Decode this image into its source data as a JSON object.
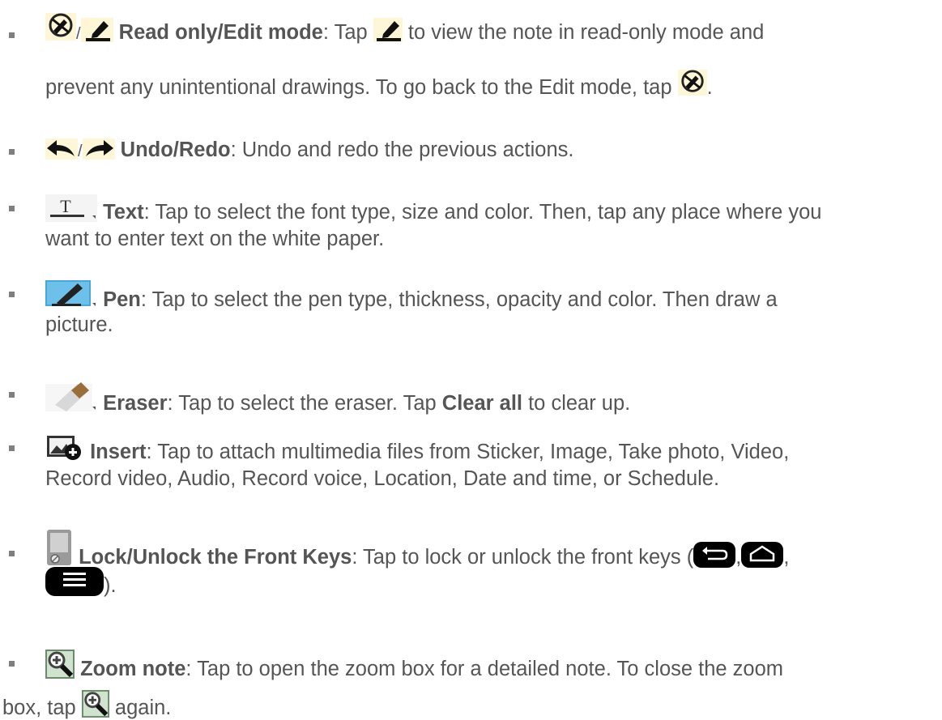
{
  "items": [
    {
      "title": "Read only/Edit mode",
      "line1_a": ": Tap ",
      "line1_b": " to view the note in read-only mode and",
      "line2_a": "prevent any unintentional drawings. To go back to the Edit mode, tap ",
      "line2_b": "."
    },
    {
      "title": "Undo/Redo",
      "line1": ": Undo and redo the previous actions."
    },
    {
      "title": "Text",
      "line1": ": Tap to select the font type, size and color. Then, tap any place where you",
      "line2": "want to enter text on the white paper."
    },
    {
      "title": "Pen",
      "line1": ": Tap to select the pen type, thickness, opacity and color. Then draw a",
      "line2": "picture."
    },
    {
      "title": "Eraser",
      "line1_a": ": Tap to select the eraser. Tap ",
      "clear_all": "Clear all",
      "line1_b": " to clear up."
    },
    {
      "title": "Insert",
      "line1": ": Tap to attach multimedia files from Sticker, Image, Take photo, Video,",
      "line2": "Record video, Audio, Record voice, Location, Date and time, or Schedule."
    },
    {
      "title": "Lock/Unlock the Front Keys",
      "line1_a": ": Tap to lock or unlock the front keys (",
      "comma1": ",",
      "comma2": ",",
      "line2_b": ")."
    },
    {
      "title": "Zoom note",
      "line1": ": Tap to open the zoom box for a detailed note. To close the zoom",
      "line2_a": "box, tap ",
      "line2_b": " again."
    }
  ],
  "separator": "/",
  "icons": [
    "read-only-icon",
    "edit-pencil-icon",
    "undo-icon",
    "redo-icon",
    "text-tool-icon",
    "pen-tool-icon",
    "eraser-tool-icon",
    "insert-media-icon",
    "lock-keys-icon",
    "back-key-icon",
    "home-key-icon",
    "menu-key-icon",
    "zoom-note-icon"
  ]
}
